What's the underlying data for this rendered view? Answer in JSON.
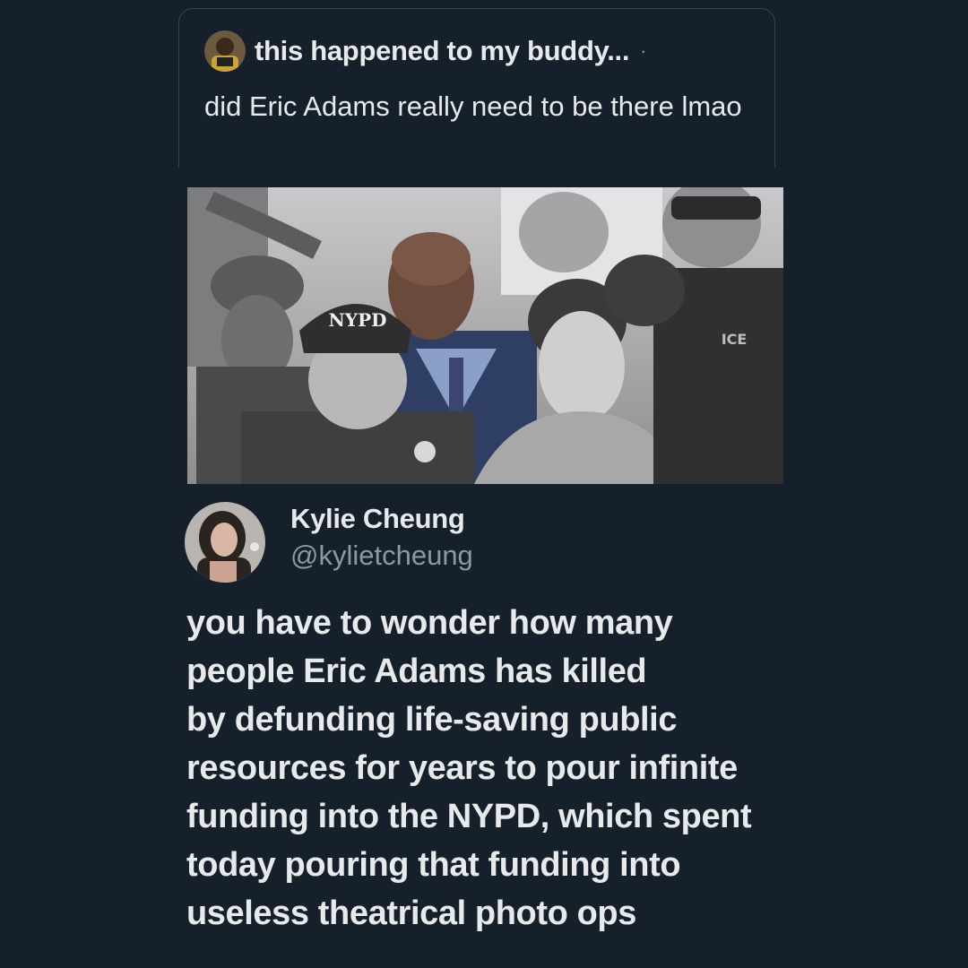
{
  "quoted_tweet": {
    "author_name": "this happened to my buddy...",
    "separator": "·",
    "text": "did Eric Adams really need to be there lmao"
  },
  "photo": {
    "helmet_text": "NYPD",
    "vest_text": "ICE"
  },
  "tweet": {
    "author_name": "Kylie Cheung",
    "handle": "@kylietcheung",
    "lines": [
      "you have to wonder how many",
      "people Eric Adams has killed",
      "by defunding life-saving public",
      "resources for years to pour infinite",
      "funding into the NYPD, which spent",
      "today pouring that funding into",
      "useless theatrical photo ops"
    ]
  },
  "colors": {
    "background": "#15202b",
    "text": "#e7e9ea",
    "muted": "#8b98a5",
    "border": "#38444d"
  }
}
